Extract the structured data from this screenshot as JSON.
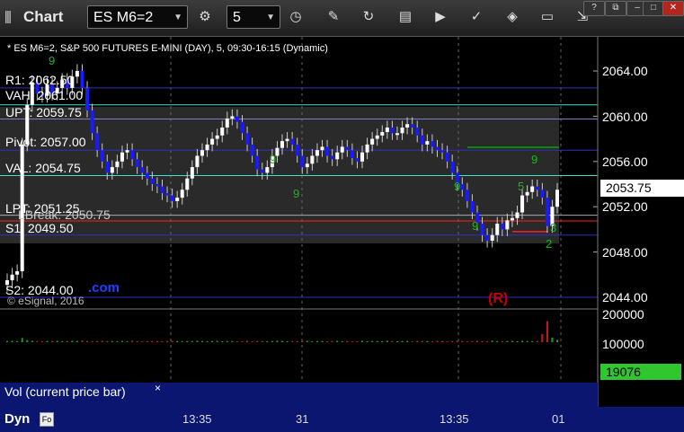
{
  "window": {
    "title": "Chart",
    "symbol": "ES M6=2",
    "interval": "5"
  },
  "chart": {
    "description": "* ES M6=2, S&P 500 FUTURES E-MINI (DAY), 5, 09:30-16:15 (Dynamic)",
    "copyright": "© eSignal, 2016",
    "watermark_suffix": ".com",
    "reversal_marker": "(R)",
    "levels": {
      "r1": "R1: 2062.50",
      "vah": "VAH: 2061.00",
      "upt": "UPT: 2059.75",
      "pivot": "Pivot: 2057.00",
      "val": "VAL: 2054.75",
      "lpt": "LPT: 2051.25",
      "lbreak": "LBreak: 2050.75",
      "s1": "S1: 2049.50",
      "s2": "S2: 2044.00"
    },
    "price_axis": [
      "2064.00",
      "2060.00",
      "2056.00",
      "2052.00",
      "2048.00",
      "2044.00"
    ],
    "current_price": "2053.75",
    "time_axis": [
      "13:35",
      "31",
      "13:35",
      "01"
    ],
    "td_counts": [
      "9",
      "9",
      "9",
      "9",
      "9",
      "5",
      "9",
      "3",
      "2"
    ]
  },
  "volume": {
    "label": "Vol (current price bar)",
    "close_label": "×",
    "axis": [
      "200000",
      "100000"
    ],
    "current": "19076"
  },
  "status": {
    "dyn": "Dyn",
    "dyn_icon": "Fo"
  },
  "colors": {
    "up_candle": "#ffffff",
    "down_candle": "#1a1aff",
    "level_blue": "#3030c0",
    "level_cyan": "#40e0d0",
    "level_green": "#00aa00",
    "level_red": "#ff2020",
    "current_price_bg": "#ffffff",
    "volume_current_bg": "#2fc62f",
    "td_green": "#18b818"
  },
  "icons": [
    "grip-icon",
    "cycle-icon",
    "clock-icon",
    "pen-icon",
    "cursor-icon",
    "tick-icon",
    "play-icon",
    "check-icon",
    "tag-icon",
    "chat-icon",
    "dock-icon"
  ],
  "chart_data": {
    "type": "line",
    "title": "* ES M6=2, S&P 500 FUTURES E-MINI (DAY), 5, 09:30-16:15 (Dynamic)",
    "ylim": [
      2042.5,
      2066.0
    ],
    "y_ticks": [
      2064,
      2060,
      2056,
      2052,
      2048,
      2044
    ],
    "x_ticks": [
      "13:35",
      "31",
      "13:35",
      "01"
    ],
    "series": [
      {
        "values": [
          2045.5,
          2046.0,
          2046.3,
          2057.5,
          2061.0,
          2063.0,
          2062.0,
          2061.8,
          2062.8,
          2062.0,
          2062.5,
          2063.2,
          2062.5,
          2063.5,
          2064.0,
          2062.5,
          2060.5,
          2058.5,
          2057.0,
          2056.0,
          2055.0,
          2055.5,
          2056.0,
          2056.8,
          2057.0,
          2056.2,
          2055.5,
          2055.0,
          2054.5,
          2054.0,
          2053.8,
          2053.2,
          2053.0,
          2052.5,
          2052.8,
          2053.5,
          2054.5,
          2055.5,
          2056.5,
          2057.0,
          2057.5,
          2058.0,
          2058.3,
          2059.0,
          2059.8,
          2060.0,
          2059.5,
          2058.5,
          2057.5,
          2056.5,
          2055.3,
          2055.0,
          2055.5,
          2056.5,
          2057.2,
          2057.8,
          2058.0,
          2057.5,
          2056.5,
          2055.5,
          2055.8,
          2056.5,
          2057.0,
          2057.3,
          2056.5,
          2056.2,
          2056.8,
          2057.3,
          2057.0,
          2056.3,
          2056.0,
          2056.8,
          2057.5,
          2058.0,
          2058.3,
          2058.6,
          2059.0,
          2058.5,
          2058.5,
          2059.0,
          2059.3,
          2059.0,
          2058.3,
          2057.5,
          2057.8,
          2057.3,
          2057.0,
          2056.8,
          2056.0,
          2055.0,
          2054.0,
          2053.5,
          2052.5,
          2051.5,
          2050.5,
          2049.5,
          2049.0,
          2049.5,
          2050.5,
          2050.0,
          2050.8,
          2051.0,
          2051.5,
          2053.0,
          2053.3,
          2053.8,
          2053.5,
          2052.8,
          2050.3,
          2052.0,
          2053.5
        ],
        "type": "price_path"
      },
      {
        "values": [
          0.05,
          0.06,
          0.05,
          0.18,
          0.09,
          0.06,
          0.05,
          0.04,
          0.05,
          0.05,
          0.06,
          0.04,
          0.05,
          0.06,
          0.05,
          0.07,
          0.05,
          0.04,
          0.05,
          0.06,
          0.05,
          0.05,
          0.04,
          0.05,
          0.04,
          0.06,
          0.05,
          0.04,
          0.05,
          0.05,
          0.05,
          0.04,
          0.05,
          0.06,
          0.05,
          0.04,
          0.05,
          0.05,
          0.06,
          0.05,
          0.04,
          0.05,
          0.06,
          0.04,
          0.05,
          0.05,
          0.04,
          0.05,
          0.06,
          0.04,
          0.05,
          0.05,
          0.04,
          0.05,
          0.06,
          0.05,
          0.04,
          0.05,
          0.04,
          0.05,
          0.06,
          0.04,
          0.05,
          0.05,
          0.04,
          0.05,
          0.06,
          0.04,
          0.05,
          0.04,
          0.05,
          0.06,
          0.04,
          0.05,
          0.05,
          0.04,
          0.06,
          0.05,
          0.04,
          0.05,
          0.05,
          0.04,
          0.06,
          0.05,
          0.05,
          0.04,
          0.06,
          0.05,
          0.04,
          0.05,
          0.06,
          0.05,
          0.04,
          0.05,
          0.06,
          0.05,
          0.04,
          0.06,
          0.05,
          0.04,
          0.05,
          0.05,
          0.04,
          0.06,
          0.05,
          0.04,
          0.05,
          0.35,
          0.9,
          0.2,
          0.1
        ],
        "type": "volume_fraction_of_max"
      }
    ]
  }
}
